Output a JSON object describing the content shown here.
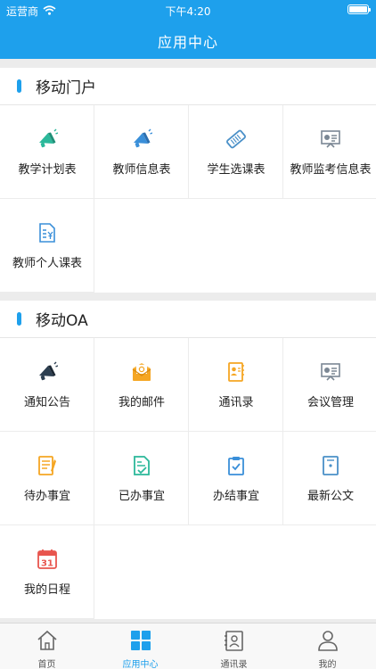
{
  "status_bar": {
    "carrier": "运营商",
    "time": "下午4:20"
  },
  "header": {
    "title": "应用中心"
  },
  "colors": {
    "accent": "#1ea0ec",
    "teal": "#2bb89a",
    "orange": "#f5a623",
    "navy": "#2c3e50",
    "red": "#e8554e"
  },
  "sections": [
    {
      "title": "移动门户",
      "items": [
        {
          "label": "教学计划表",
          "icon": "megaphone-green-icon"
        },
        {
          "label": "教师信息表",
          "icon": "megaphone-blue-icon"
        },
        {
          "label": "学生选课表",
          "icon": "ticket-icon"
        },
        {
          "label": "教师监考信息表",
          "icon": "presentation-board-icon"
        },
        {
          "label": "教师个人课表",
          "icon": "receipt-yuan-icon"
        }
      ]
    },
    {
      "title": "移动OA",
      "items": [
        {
          "label": "通知公告",
          "icon": "megaphone-dark-icon"
        },
        {
          "label": "我的邮件",
          "icon": "mail-icon"
        },
        {
          "label": "通讯录",
          "icon": "contacts-book-icon"
        },
        {
          "label": "会议管理",
          "icon": "meeting-board-icon"
        },
        {
          "label": "待办事宜",
          "icon": "todo-document-icon"
        },
        {
          "label": "已办事宜",
          "icon": "done-document-icon"
        },
        {
          "label": "办结事宜",
          "icon": "clipboard-check-icon"
        },
        {
          "label": "最新公文",
          "icon": "document-icon"
        },
        {
          "label": "我的日程",
          "icon": "calendar-31-icon",
          "calendar_day": "31"
        }
      ]
    }
  ],
  "tabbar": [
    {
      "label": "首页",
      "icon": "home-icon",
      "active": false
    },
    {
      "label": "应用中心",
      "icon": "app-grid-icon",
      "active": true
    },
    {
      "label": "通讯录",
      "icon": "address-book-icon",
      "active": false
    },
    {
      "label": "我的",
      "icon": "profile-icon",
      "active": false
    }
  ]
}
